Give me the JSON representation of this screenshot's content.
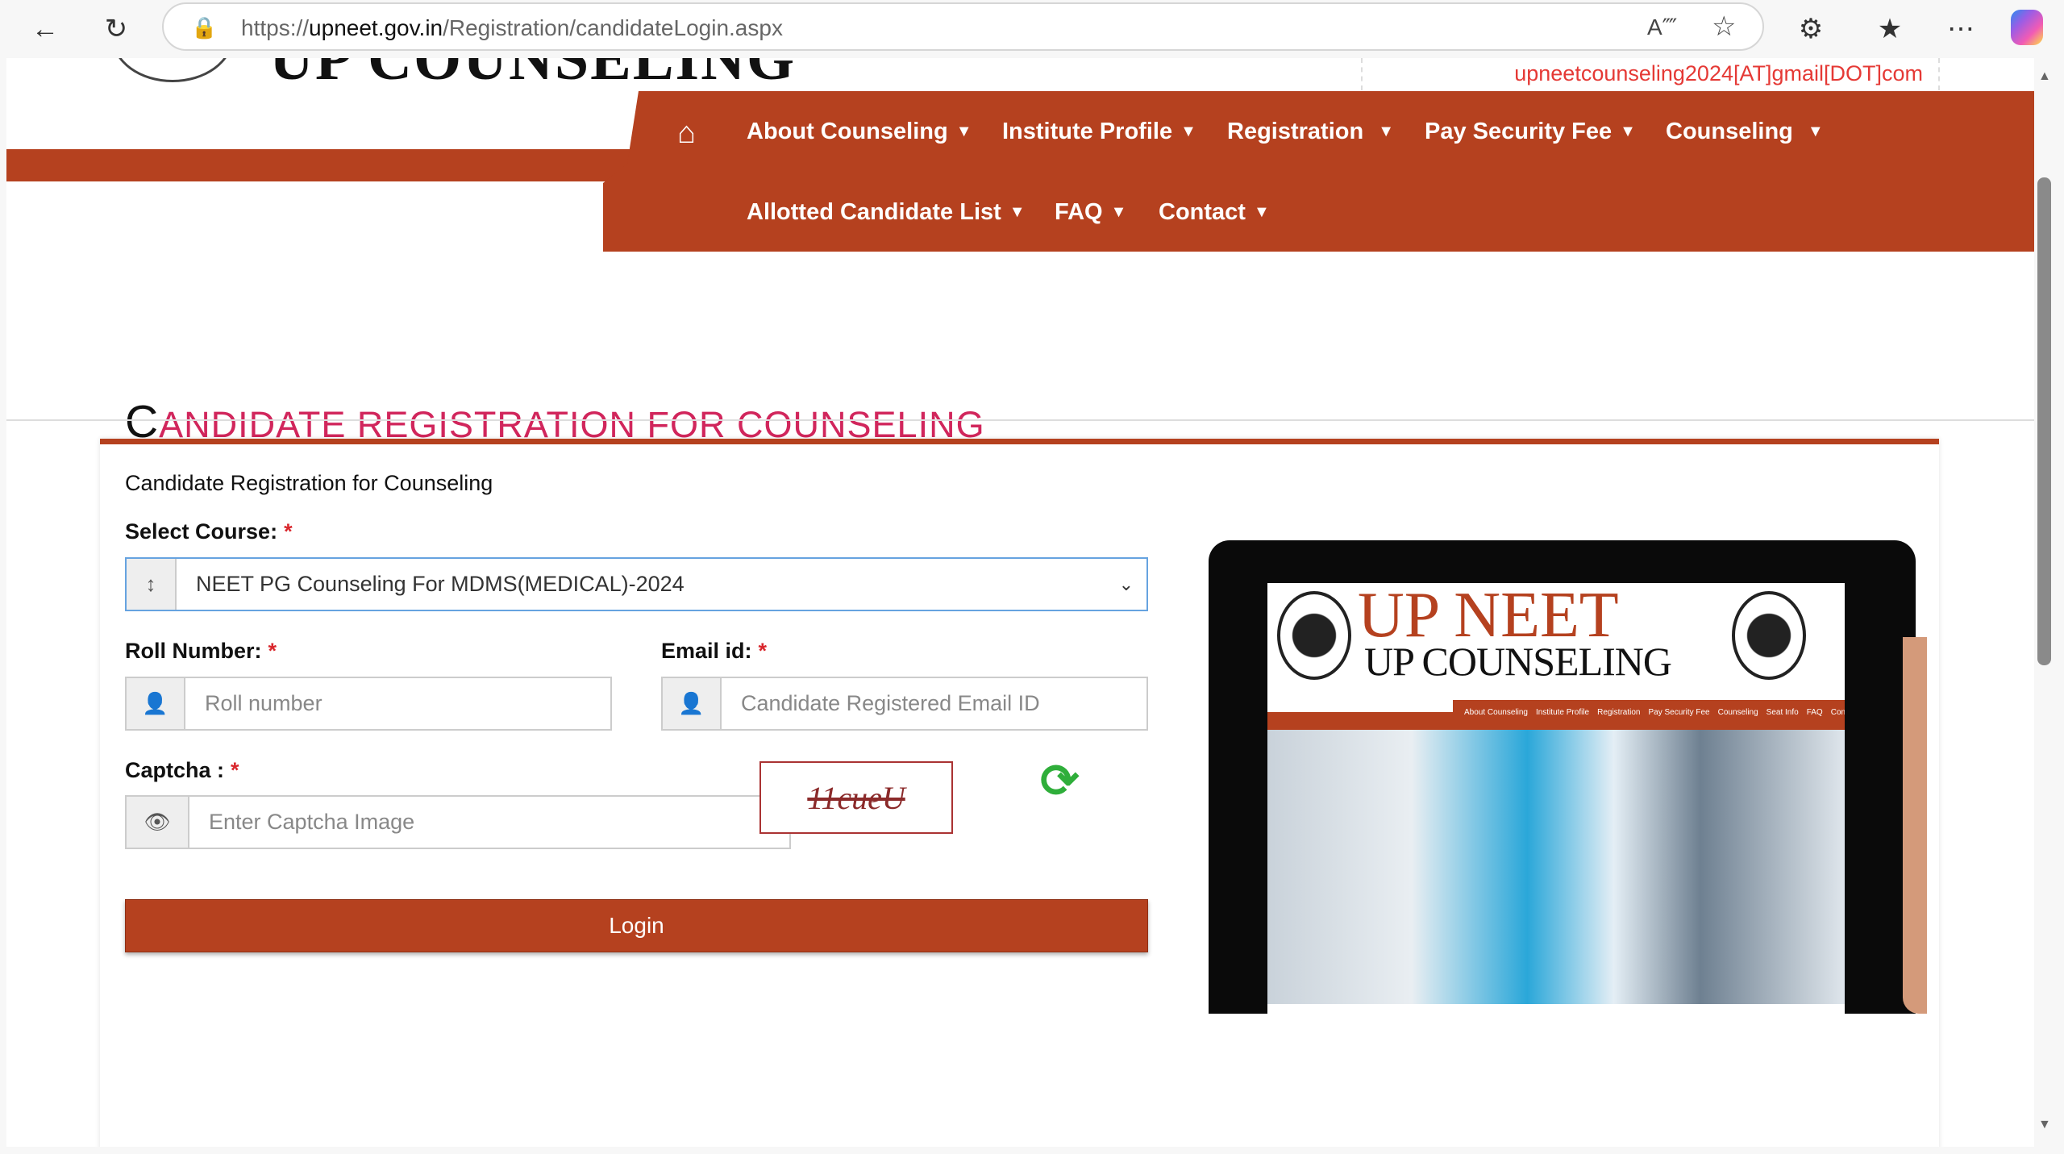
{
  "browser": {
    "url_host": "upneet.gov.in",
    "url_scheme": "https://",
    "url_path": "/Registration/candidateLogin.aspx",
    "icons": [
      "back-icon",
      "refresh-icon",
      "lock-icon",
      "read-aloud-icon",
      "favorite-star-icon",
      "extensions-icon",
      "favorites-icon",
      "more-icon",
      "copilot-icon"
    ]
  },
  "header": {
    "logo_text": "UP COUNSELING",
    "email": "upneetcounseling2024[AT]gmail[DOT]com"
  },
  "nav": {
    "row1": [
      "About Counseling",
      "Institute Profile",
      "Registration",
      "Pay Security Fee",
      "Counseling"
    ],
    "row2": [
      "Allotted Candidate List",
      "FAQ",
      "Contact"
    ],
    "color": "#b5411f"
  },
  "page": {
    "title_first": "C",
    "title_rest": "ANDIDATE REGISTRATION FOR COUNSELING"
  },
  "form": {
    "subtitle": "Candidate Registration for Counseling",
    "course_label": "Select Course:",
    "course_value": "NEET PG Counseling For MDMS(MEDICAL)-2024",
    "roll_label": "Roll Number:",
    "roll_placeholder": "Roll number",
    "email_label": "Email id:",
    "email_placeholder": "Candidate Registered Email ID",
    "captcha_label": "Captcha :",
    "captcha_placeholder": "Enter Captcha Image",
    "captcha_text": "11cueU",
    "required_mark": "*",
    "login_label": "Login"
  },
  "banner": {
    "title": "UP NEET",
    "subtitle": "UP COUNSELING",
    "nav": [
      "About Counseling",
      "Institute Profile",
      "Registration",
      "Pay Security Fee",
      "Counseling",
      "Seat Info",
      "FAQ",
      "Contact"
    ]
  }
}
